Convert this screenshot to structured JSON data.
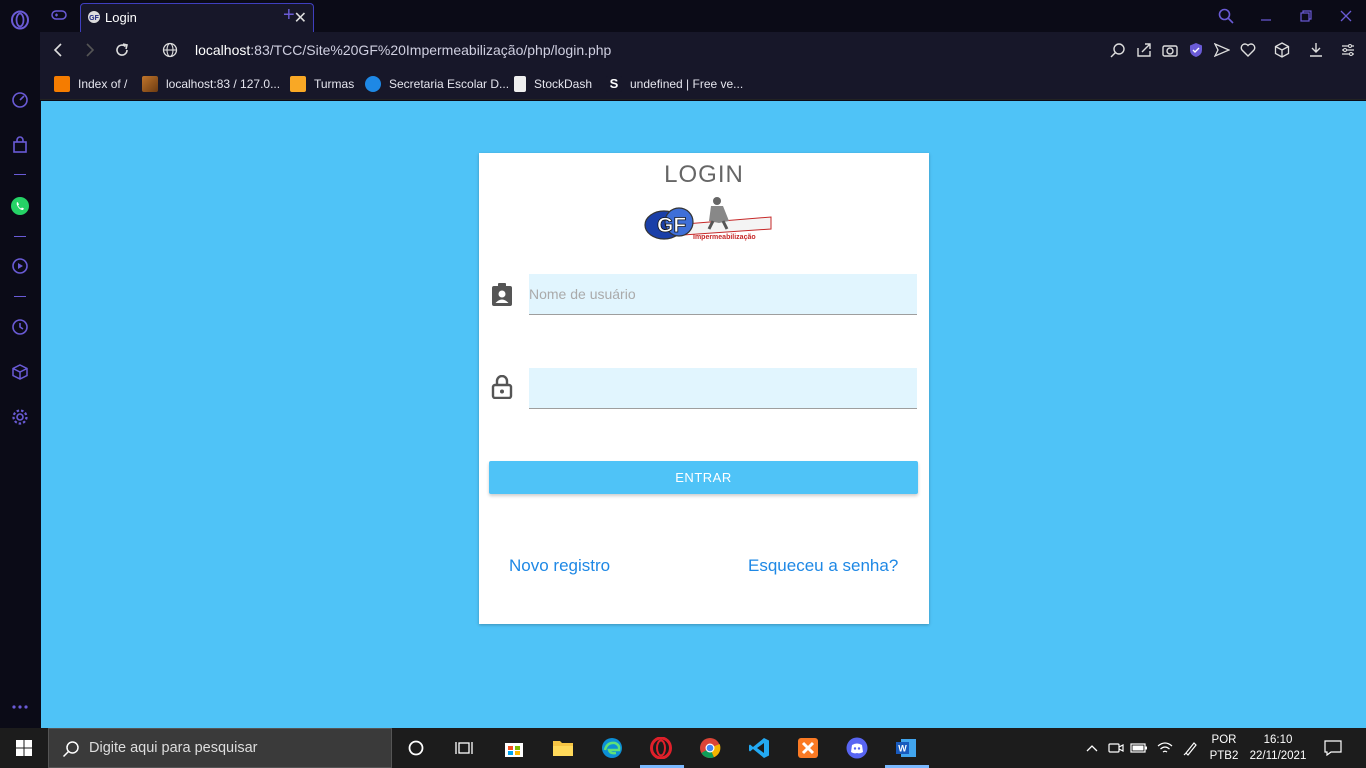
{
  "browser": {
    "tab_title": "Login",
    "url_host": "localhost",
    "url_rest": ":83/TCC/Site%20GF%20Impermeabilização/php/login.php"
  },
  "bookmarks": [
    {
      "label": "Index of /",
      "color": "#f57c00"
    },
    {
      "label": "localhost:83 / 127.0...",
      "color": "#c0752b"
    },
    {
      "label": "Turmas",
      "color": "#f9a825"
    },
    {
      "label": "Secretaria Escolar D...",
      "color": "#1e88e5"
    },
    {
      "label": "StockDash",
      "color": "#eeeeee"
    },
    {
      "label": "undefined | Free ve...",
      "color": "#ffffff"
    }
  ],
  "login": {
    "title": "LOGIN",
    "logo_text": "GF",
    "logo_subtext": "Impermeabilização",
    "username_placeholder": "Nome de usuário",
    "password_placeholder": "",
    "submit_label": "ENTRAR",
    "register_link": "Novo registro",
    "forgot_link": "Esqueceu a senha?"
  },
  "taskbar": {
    "search_placeholder": "Digite aqui para pesquisar",
    "lang_top": "POR",
    "lang_bottom": "PTB2",
    "time": "16:10",
    "date": "22/11/2021"
  },
  "colors": {
    "page_background": "#4fc3f7",
    "accent_link": "#1e88e5",
    "browser_accent": "#6a5bd6"
  }
}
